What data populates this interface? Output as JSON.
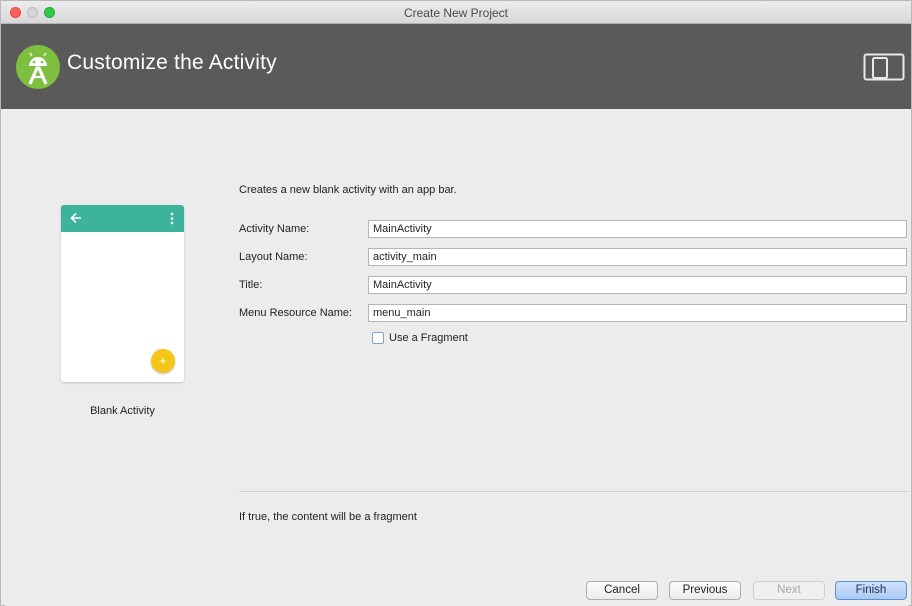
{
  "window": {
    "title": "Create New Project"
  },
  "header": {
    "title": "Customize the Activity",
    "logo_icon": "android-studio-icon",
    "device_icon": "phone-tablet-icon",
    "background": "#5a5a5a"
  },
  "preview": {
    "template_name": "Blank Activity",
    "appbar_color": "#3db39e",
    "fab_color": "#f5c518",
    "fab_symbol": "+"
  },
  "form": {
    "description": "Creates a new blank activity with an app bar.",
    "activity_name_label": "Activity Name:",
    "activity_name_value": "MainActivity",
    "layout_name_label": "Layout Name:",
    "layout_name_value": "activity_main",
    "title_label": "Title:",
    "title_value": "MainActivity",
    "menu_resource_label": "Menu Resource Name:",
    "menu_resource_value": "menu_main",
    "use_fragment_label": "Use a Fragment",
    "use_fragment_checked": false
  },
  "help": {
    "text": "If true, the content will be a fragment"
  },
  "buttons": {
    "cancel": "Cancel",
    "previous": "Previous",
    "next": "Next",
    "finish": "Finish"
  }
}
